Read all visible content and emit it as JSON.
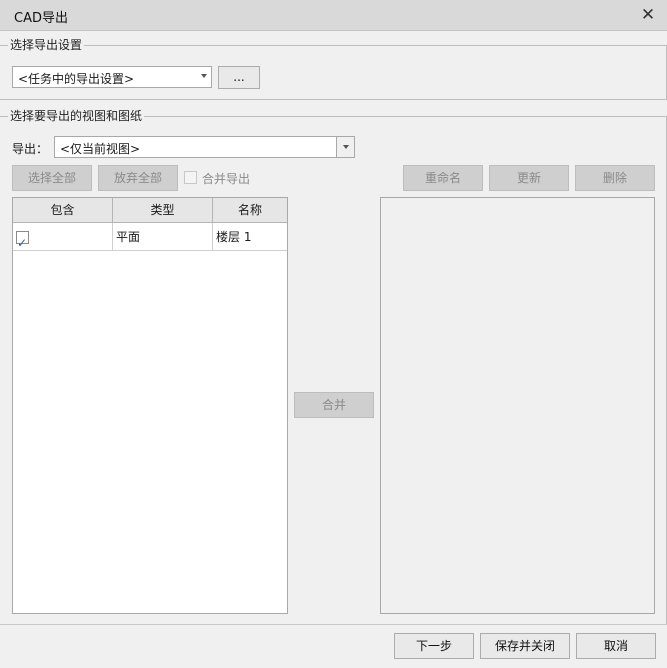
{
  "window": {
    "title": "CAD导出",
    "close_symbol": "✕"
  },
  "export_settings": {
    "group_label": "选择导出设置",
    "setting_value": "<任务中的导出设置>",
    "browse_label": "..."
  },
  "views": {
    "group_label": "选择要导出的视图和图纸",
    "export_label": "导出：",
    "export_value": "<仅当前视图>",
    "select_all": "选择全部",
    "deselect_all": "放弃全部",
    "merge_export_label": "合并导出",
    "rename": "重命名",
    "update": "更新",
    "delete": "删除",
    "merge": "合并"
  },
  "table": {
    "columns": [
      "包含",
      "类型",
      "名称"
    ],
    "rows": [
      {
        "include": true,
        "type": "平面",
        "name": "楼层 1"
      }
    ]
  },
  "footer": {
    "next": "下一步",
    "save_close": "保存并关闭",
    "cancel": "取消"
  }
}
